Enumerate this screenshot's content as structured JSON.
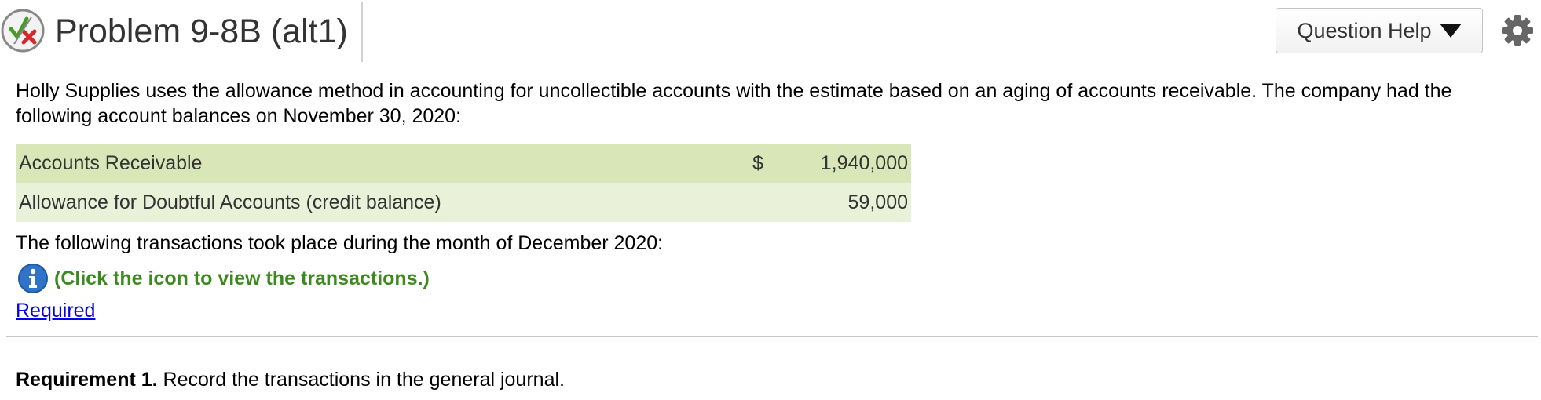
{
  "header": {
    "title": "Problem 9-8B (alt1)",
    "help_button_label": "Question Help",
    "status_icon": "partial-correct-icon",
    "settings_icon": "gear-icon"
  },
  "problem": {
    "intro": "Holly Supplies uses the allowance method in accounting for uncollectible accounts with the estimate based on an aging of accounts receivable. The company had the following account balances on November 30, 2020:",
    "balances": [
      {
        "label": "Accounts Receivable",
        "currency": "$",
        "value": "1,940,000"
      },
      {
        "label": "Allowance for Doubtful Accounts (credit balance)",
        "currency": "",
        "value": "59,000"
      }
    ],
    "transactions_intro": "The following transactions took place during the month of December 2020:",
    "info_link_text": "(Click the icon to view the transactions.)",
    "required_link": "Required"
  },
  "requirement": {
    "label": "Requirement 1.",
    "text": " Record the transactions in the general journal."
  },
  "colors": {
    "row_dark": "#d9e6b8",
    "row_light": "#e9f1d9",
    "info_green": "#3c8a1e",
    "link_blue": "#0000ee"
  }
}
